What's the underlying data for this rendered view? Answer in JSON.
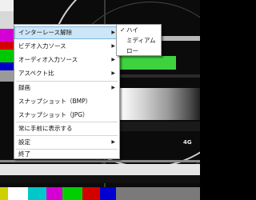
{
  "main_menu": {
    "items": [
      {
        "label": "インターレース解除",
        "has_submenu": true
      },
      {
        "label": "ビデオ入力ソース",
        "has_submenu": true
      },
      {
        "label": "オーディオ入力ソース",
        "has_submenu": true
      },
      {
        "label": "アスペクト比",
        "has_submenu": true
      },
      {
        "label": "録画",
        "has_submenu": true
      },
      {
        "label": "スナップショット（BMP）",
        "has_submenu": false
      },
      {
        "label": "スナップショット（JPG）",
        "has_submenu": false
      },
      {
        "label": "常に手前に表示する",
        "has_submenu": false
      },
      {
        "label": "設定",
        "has_submenu": true
      },
      {
        "label": "終了",
        "has_submenu": false
      }
    ],
    "submenu_arrow": "▶"
  },
  "deinterlace_submenu": {
    "items": [
      {
        "label": "ハイ",
        "checked": true
      },
      {
        "label": "ミディアム",
        "checked": false
      },
      {
        "label": "ロー",
        "checked": false
      }
    ],
    "check_mark": "✓"
  },
  "background": {
    "logo_text": "4G"
  },
  "colors": {
    "highlight": "#cde6f7",
    "highlight_border": "#7db4dc"
  }
}
